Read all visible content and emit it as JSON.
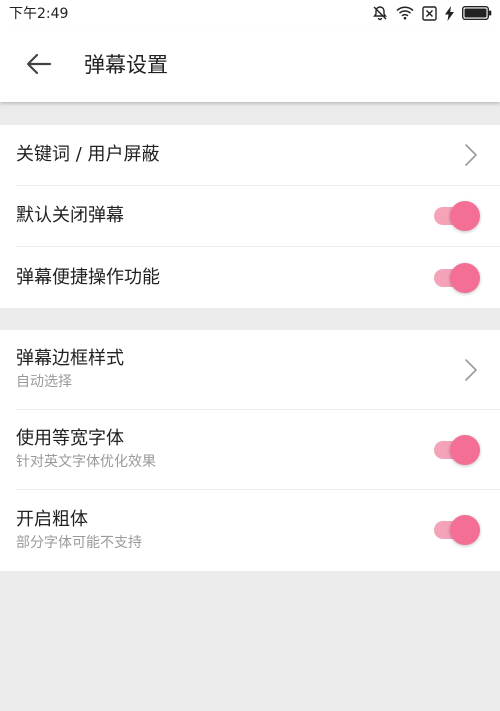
{
  "status_bar": {
    "time": "下午2:49",
    "icons": [
      "bell-off-icon",
      "wifi-icon",
      "no-sim-icon",
      "charging-bolt-icon",
      "battery-icon"
    ]
  },
  "header": {
    "title": "弹幕设置",
    "back_icon": "arrow-left-icon"
  },
  "group1": {
    "items": [
      {
        "label": "关键词 / 用户屏蔽",
        "control": "chevron"
      },
      {
        "label": "默认关闭弹幕",
        "control": "switch",
        "on": true
      },
      {
        "label": "弹幕便捷操作功能",
        "control": "switch",
        "on": true
      }
    ]
  },
  "group2": {
    "items": [
      {
        "label": "弹幕边框样式",
        "sub": "自动选择",
        "control": "chevron"
      },
      {
        "label": "使用等宽字体",
        "sub": "针对英文字体优化效果",
        "control": "switch",
        "on": true
      },
      {
        "label": "开启粗体",
        "sub": "部分字体可能不支持",
        "control": "switch",
        "on": true
      }
    ]
  },
  "colors": {
    "accent": "#f46f95",
    "accent_track": "#f4a3b8",
    "background": "#ebebeb",
    "secondary_text": "#9a9a9a"
  }
}
